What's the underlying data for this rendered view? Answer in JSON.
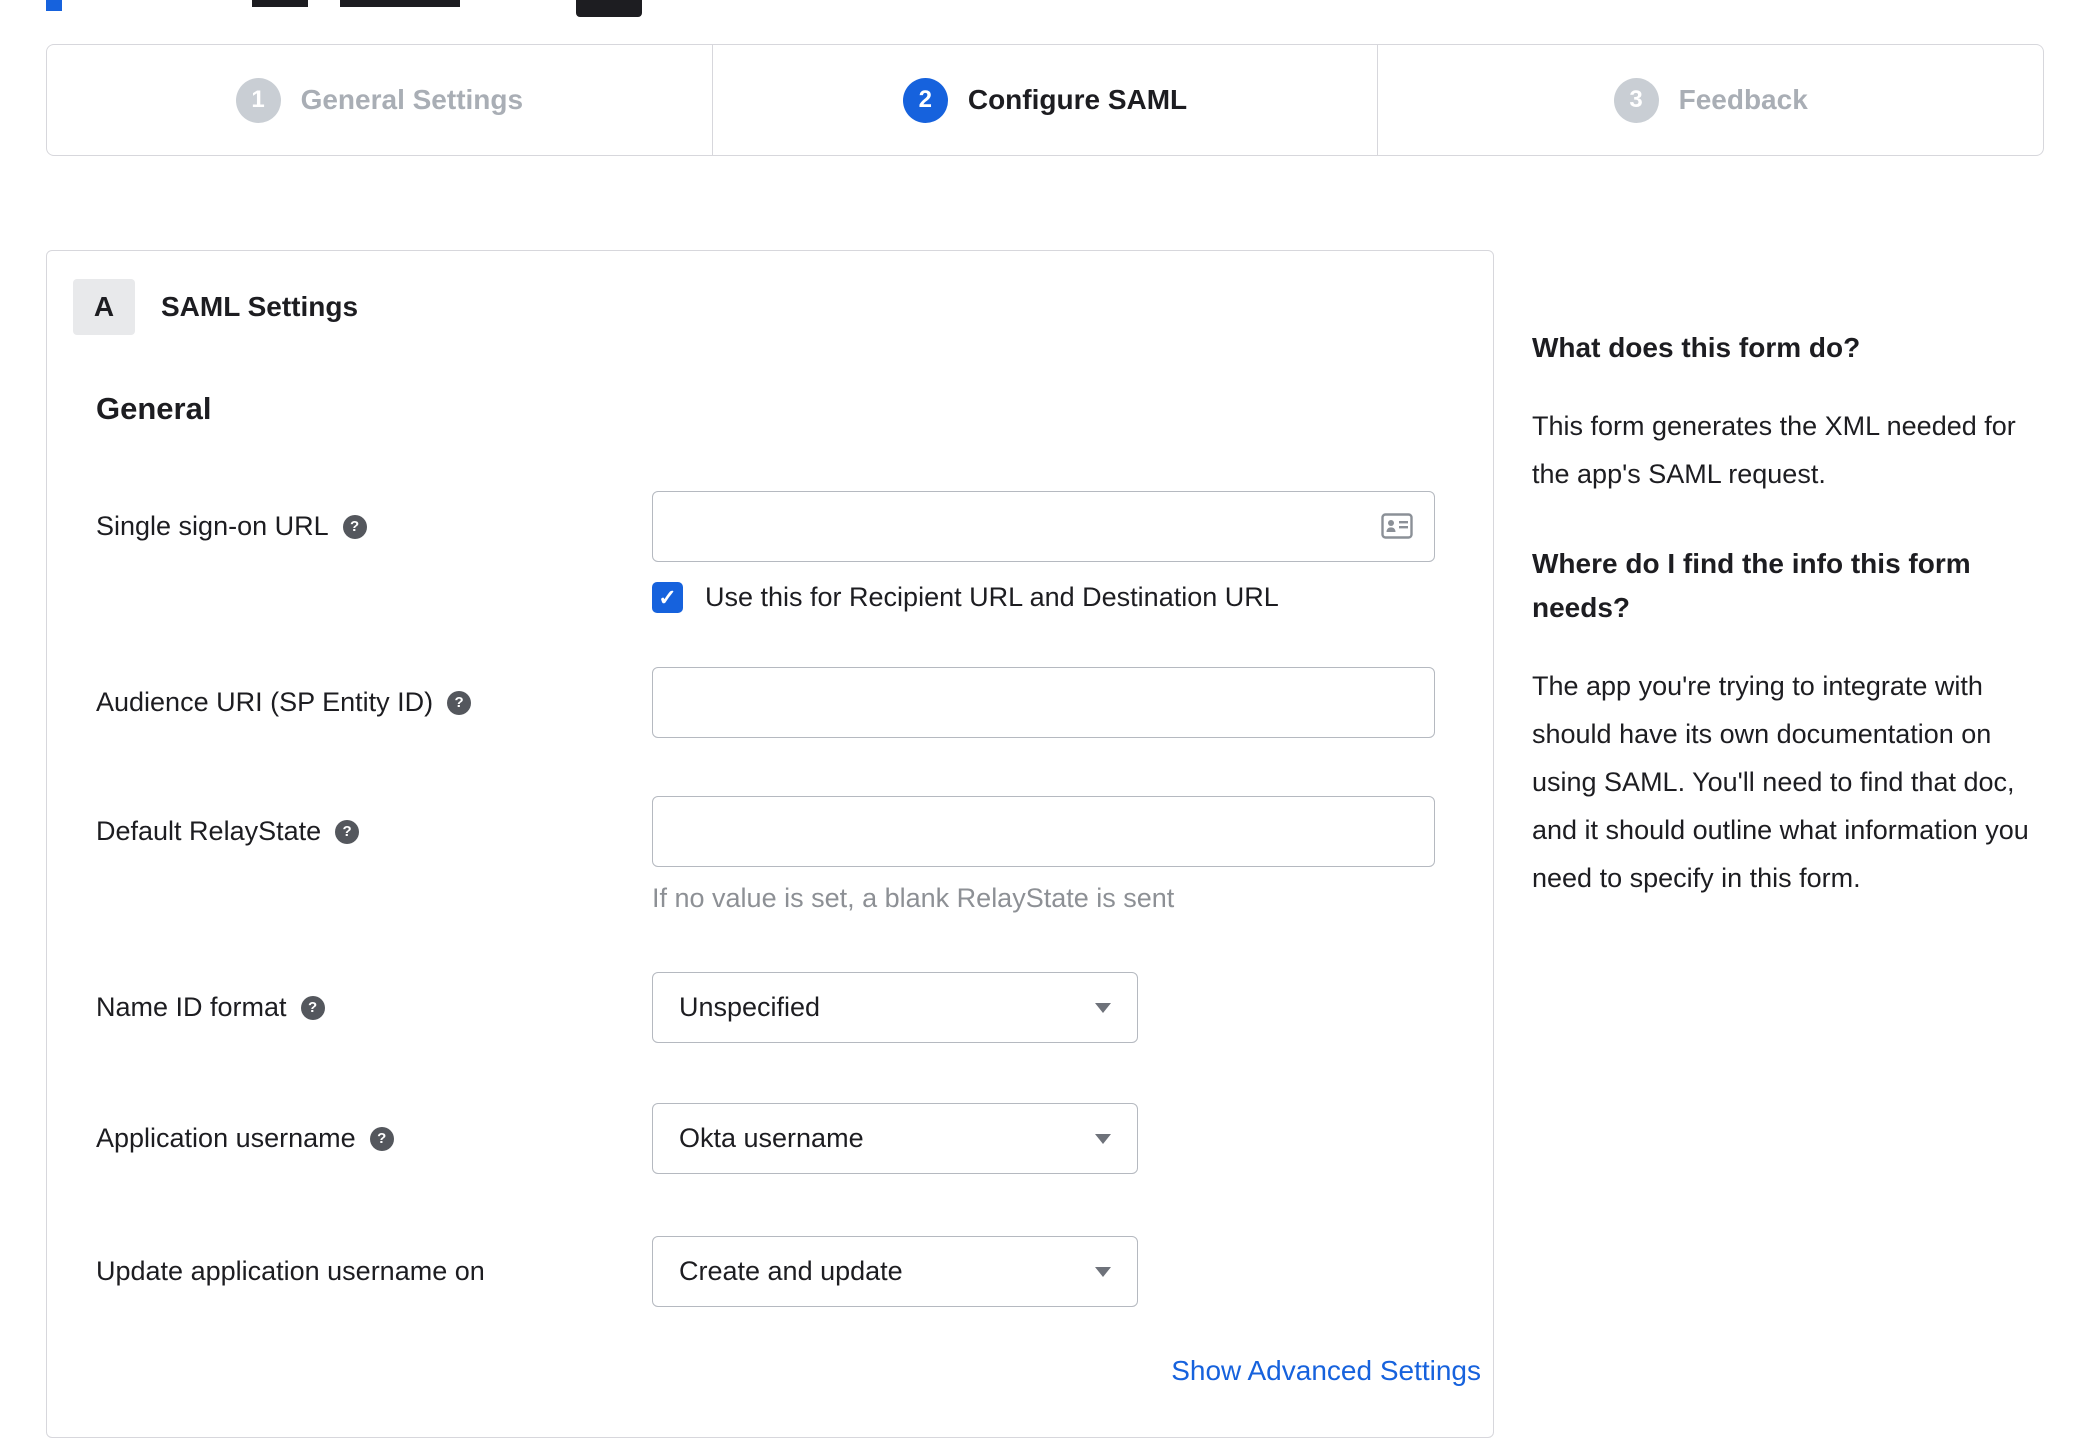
{
  "stepper": {
    "steps": [
      {
        "number": "1",
        "label": "General Settings",
        "state": "inactive"
      },
      {
        "number": "2",
        "label": "Configure SAML",
        "state": "active"
      },
      {
        "number": "3",
        "label": "Feedback",
        "state": "inactive"
      }
    ]
  },
  "panel": {
    "section_badge": "A",
    "section_title": "SAML Settings",
    "group_title": "General",
    "fields": {
      "sso": {
        "label": "Single sign-on URL",
        "value": "",
        "checkbox_label": "Use this for Recipient URL and Destination URL",
        "checkbox_checked": true
      },
      "audience": {
        "label": "Audience URI (SP Entity ID)",
        "value": ""
      },
      "relay": {
        "label": "Default RelayState",
        "value": "",
        "hint": "If no value is set, a blank RelayState is sent"
      },
      "nameid": {
        "label": "Name ID format",
        "value": "Unspecified"
      },
      "app_username": {
        "label": "Application username",
        "value": "Okta username"
      },
      "update_username": {
        "label": "Update application username on",
        "value": "Create and update"
      }
    },
    "advanced_link": "Show Advanced Settings"
  },
  "help_panel": {
    "q1": "What does this form do?",
    "a1": "This form generates the XML needed for the app's SAML request.",
    "q2": "Where do I find the info this form needs?",
    "a2": "The app you're trying to integrate with should have its own documentation on using SAML. You'll need to find that doc, and it should outline what information you need to specify in this form."
  },
  "icons": {
    "help": "question-mark-icon",
    "check": "✓",
    "sso_field": "contact-card-icon"
  },
  "colors": {
    "accent": "#1662dd",
    "link": "#1662dd",
    "inactive_step": "#c9ced4",
    "hint_text": "#8d9095"
  }
}
